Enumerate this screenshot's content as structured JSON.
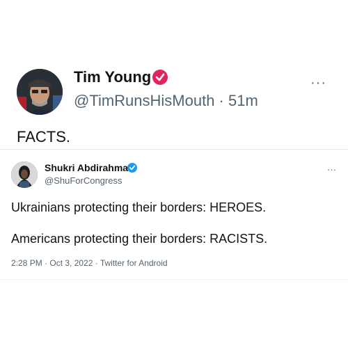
{
  "tweet": {
    "author_name": "Tim Young",
    "author_handle": "@TimRunsHisMouth · 51m",
    "body": "FACTS.",
    "more": "···",
    "badge_color": "#e0245e",
    "avatar_icon": "user-avatar-photo",
    "badge_icon": "verified-check-icon"
  },
  "quoted": {
    "author_name": "Shukri Abdirahman",
    "author_handle": "@ShuForCongress",
    "line1": "Ukrainians protecting their borders: HEROES.",
    "line2": "Americans protecting their borders: RACISTS.",
    "meta": "2:28 PM · Oct 3, 2022 · Twitter for Android",
    "more": "···",
    "badge_color": "#1d9bf0",
    "avatar_icon": "user-avatar-photo",
    "badge_icon": "verified-check-icon"
  }
}
